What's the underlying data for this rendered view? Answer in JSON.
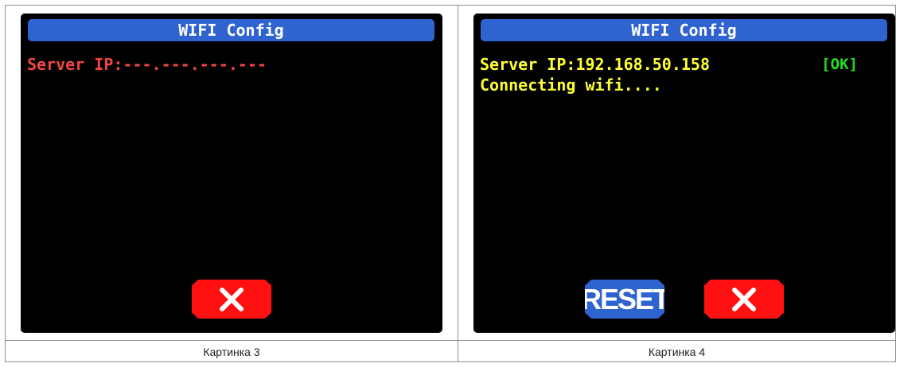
{
  "panels": [
    {
      "title": "WIFI Config",
      "lines": [
        "Server IP:---.---.---.---"
      ],
      "caption": "Картинка 3",
      "close_icon": "x-icon"
    },
    {
      "title": "WIFI Config",
      "lines": [
        "Server IP:192.168.50.158",
        "Connecting wifi...."
      ],
      "status": "[OK]",
      "reset_label": "RESET",
      "caption": "Картинка 4",
      "close_icon": "x-icon"
    }
  ],
  "colors": {
    "screen_bg": "#000000",
    "title_bar": "#2f63d0",
    "error_text": "#f14545",
    "info_text": "#ffff33",
    "ok_text": "#22dd22",
    "close_button": "#ff1111",
    "reset_button": "#2f63d0"
  }
}
